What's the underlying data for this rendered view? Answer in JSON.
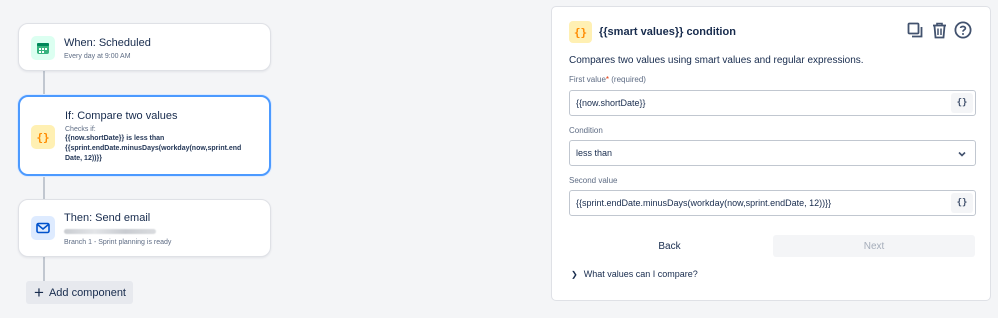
{
  "flow": {
    "trigger": {
      "icon": "calendar-icon",
      "title": "When: Scheduled",
      "subtitle": "Every day at 9:00 AM"
    },
    "condition": {
      "icon": "curly-braces-icon",
      "icon_text": "{}",
      "title": "If: Compare two values",
      "label": "Checks if:",
      "expression_line1": "{{now.shortDate}} is less than",
      "expression_line2": "{{sprint.endDate.minusDays(workday(now,sprint.end",
      "expression_line3": "Date, 12))}}"
    },
    "action": {
      "icon": "mail-icon",
      "title": "Then: Send email",
      "subtitle": "Branch 1 - Sprint planning is ready"
    },
    "add_component_label": "Add component"
  },
  "panel": {
    "icon_text": "{}",
    "title": "{{smart values}} condition",
    "tools": [
      "copy-icon",
      "trash-icon",
      "help-icon"
    ],
    "description": "Compares two values using smart values and regular expressions.",
    "first_value": {
      "label": "First value",
      "required_mark": "*",
      "hint": "(required)",
      "value": "{{now.shortDate}}",
      "smart_button": "{}"
    },
    "condition": {
      "label": "Condition",
      "selected": "less than"
    },
    "second_value": {
      "label": "Second value",
      "value": "{{sprint.endDate.minusDays(workday(now,sprint.endDate, 12))}}",
      "smart_button": "{}"
    },
    "back_label": "Back",
    "next_label": "Next",
    "expander_label": "What values can I compare?"
  },
  "colors": {
    "accent_blue": "#4c9aff",
    "condition_yellow": "#fff0b3",
    "trigger_green": "#dcfff1",
    "action_blue": "#deebff"
  }
}
